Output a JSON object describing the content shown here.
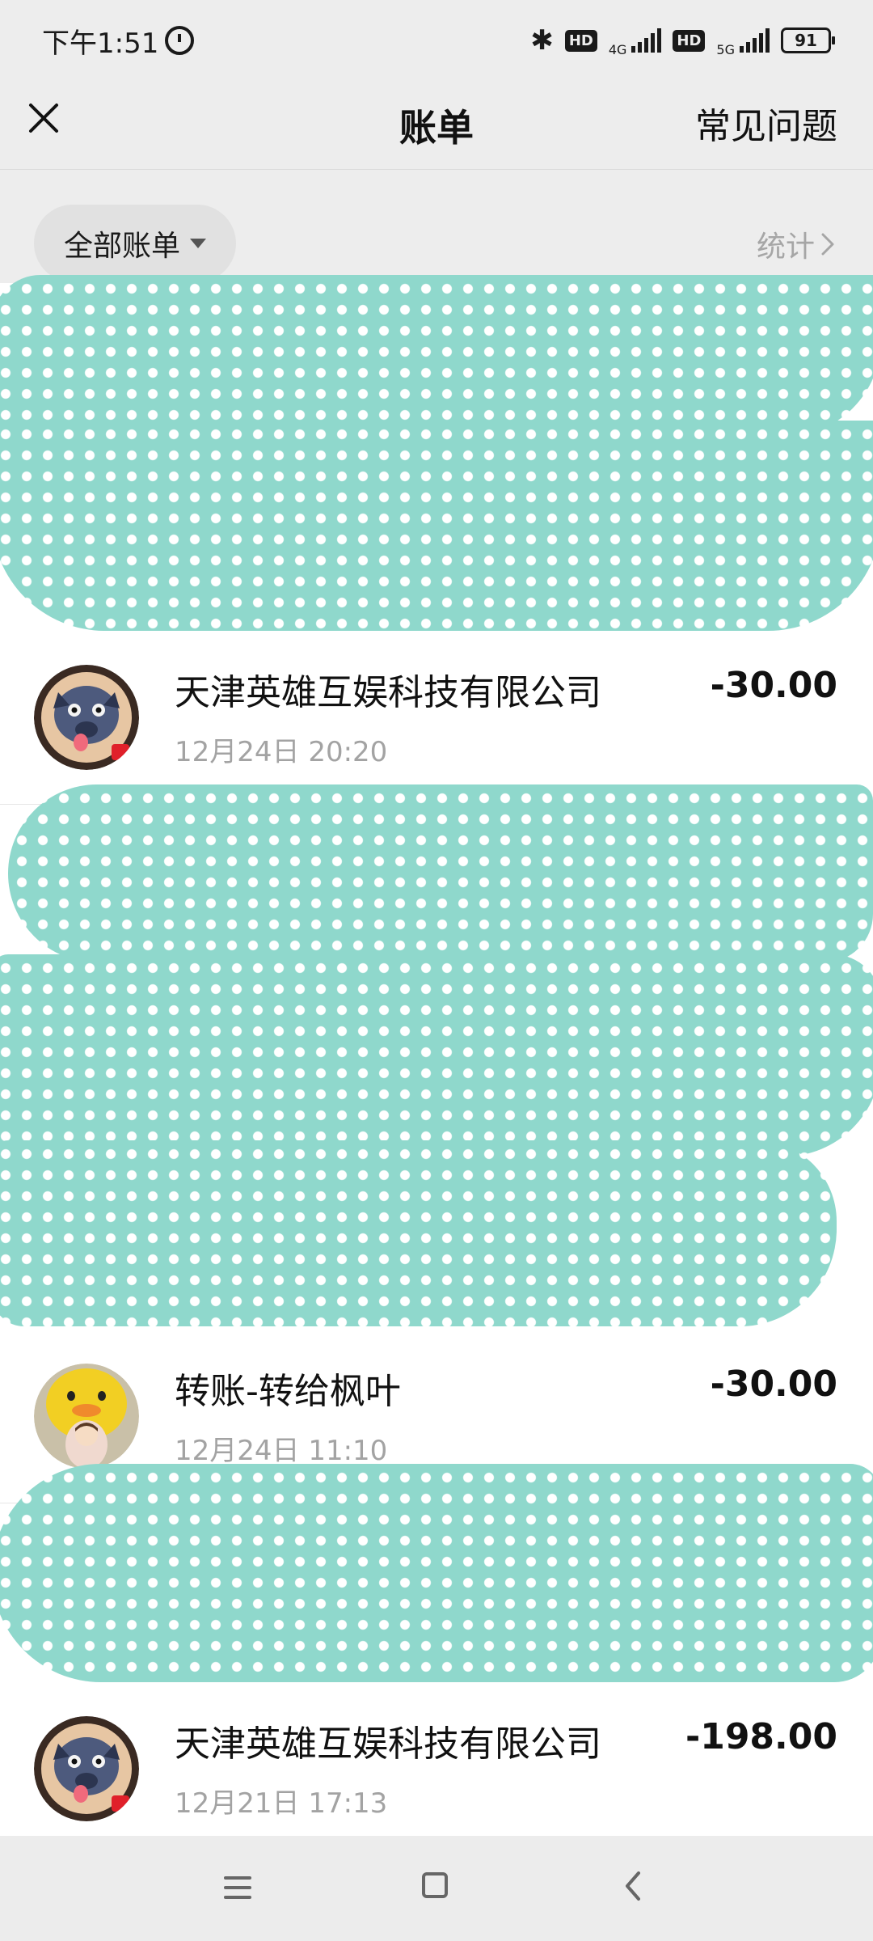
{
  "status_bar": {
    "time": "下午1:51",
    "net_1": "4G",
    "net_2": "5G",
    "hd": "HD",
    "battery": "91"
  },
  "nav": {
    "title": "账单",
    "faq": "常见问题"
  },
  "filter": {
    "label": "全部账单",
    "stats": "统计"
  },
  "bills": [
    {
      "title": "天津英雄互娱科技有限公司",
      "time": "12月24日 20:20",
      "amount": "-30.00"
    },
    {
      "title": "转账-转给枫叶",
      "time": "12月24日 11:10",
      "amount": "-30.00"
    },
    {
      "title": "天津英雄互娱科技有限公司",
      "time": "12月21日 17:13",
      "amount": "-198.00"
    }
  ],
  "colors": {
    "redaction": "#8fd8cc",
    "background": "#ededed"
  }
}
